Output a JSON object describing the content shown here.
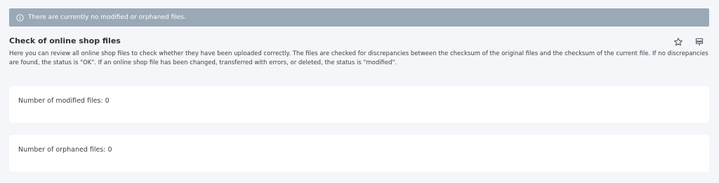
{
  "alert": {
    "icon": "info-icon",
    "message": "There are currently no modified or orphaned files."
  },
  "header": {
    "title": "Check of online shop files",
    "actions": {
      "favorite_icon": "star-icon",
      "layout_icon": "layout-icon"
    }
  },
  "description": "Here you can review all online shop files to check whether they have been uploaded correctly. The files are checked for discrepancies between the checksum of the original files and the checksum of the current file. If no discrepancies are found, the status is \"OK\". If an online shop file has been changed, transferred with errors, or deleted, the status is \"modified\".",
  "cards": {
    "modified": "Number of modified files: 0",
    "orphaned": "Number of orphaned files: 0"
  },
  "colors": {
    "alert_bg": "#9aa9b6",
    "page_bg": "#f4f6f9",
    "card_bg": "#ffffff"
  }
}
